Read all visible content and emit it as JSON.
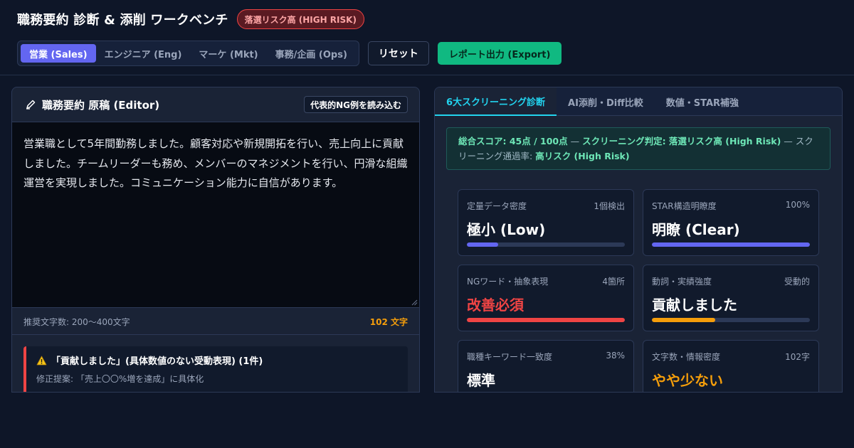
{
  "header": {
    "title": "職務要約 診断 & 添削 ワークベンチ",
    "risk_badge": "落選リスク高 (HIGH RISK)",
    "segments": [
      {
        "label": "営業 (Sales)",
        "active": true
      },
      {
        "label": "エンジニア (Eng)",
        "active": false
      },
      {
        "label": "マーケ (Mkt)",
        "active": false
      },
      {
        "label": "事務/企画 (Ops)",
        "active": false
      }
    ],
    "reset_label": "リセット",
    "export_label": "レポート出力 (Export)"
  },
  "editor_panel": {
    "title": "職務要約 原稿 (Editor)",
    "icon": "pen-icon",
    "load_ng_label": "代表的NG例を読み込む",
    "text": "営業職として5年間勤務しました。顧客対応や新規開拓を行い、売上向上に貢献しました。チームリーダーも務め、メンバーのマネジメントを行い、円滑な組織運営を実現しました。コミュニケーション能力に自信があります。",
    "count_hint": "推奨文字数: 200〜400文字",
    "count_value": "102 文字",
    "issue": {
      "icon": "warning-icon",
      "title": "「貢献しました」(具体数値のない受動表現) (1件)",
      "suggestion": "修正提案: 「売上〇〇%増を達成」に具体化"
    }
  },
  "diagnosis_panel": {
    "tabs": [
      {
        "label": "6大スクリーニング診断",
        "active": true
      },
      {
        "label": "AI添削・Diff比較",
        "active": false
      },
      {
        "label": "数値・STAR補強",
        "active": false
      }
    ],
    "summary": {
      "score_label": "総合スコア: 45点 / 100点",
      "sep1": " — ",
      "verdict_label": "スクリーニング判定: 落選リスク高 (High Risk)",
      "sep2": " — スクリーニング通過率: ",
      "pass_rate": "高リスク (High Risk)"
    },
    "metrics": [
      {
        "name": "定量データ密度",
        "meta": "1個検出",
        "value": "極小 (Low)",
        "value_color": "#ffffff",
        "bar_color": "#6366f1",
        "fill": 0.2
      },
      {
        "name": "STAR構造明瞭度",
        "meta": "100%",
        "value": "明瞭 (Clear)",
        "value_color": "#ffffff",
        "bar_color": "#6366f1",
        "fill": 1.0
      },
      {
        "name": "NGワード・抽象表現",
        "meta": "4箇所",
        "value": "改善必須",
        "value_color": "#ef4444",
        "bar_color": "#ef4444",
        "fill": 1.0
      },
      {
        "name": "動詞・実績強度",
        "meta": "受動的",
        "value": "貢献しました",
        "value_color": "#ffffff",
        "bar_color": "#f59e0b",
        "fill": 0.4
      },
      {
        "name": "職種キーワード一致度",
        "meta": "38%",
        "value": "標準",
        "value_color": "#ffffff",
        "bar_color": "#6366f1",
        "fill": 0.38
      },
      {
        "name": "文字数・情報密度",
        "meta": "102字",
        "value": "やや少ない",
        "value_color": "#f59e0b",
        "bar_color": "#f59e0b",
        "fill": 0.5
      }
    ]
  },
  "colors": {
    "accent": "#6366f1",
    "danger": "#ef4444",
    "warning": "#f59e0b",
    "success": "#10b981",
    "tab_active": "#22d3ee"
  }
}
